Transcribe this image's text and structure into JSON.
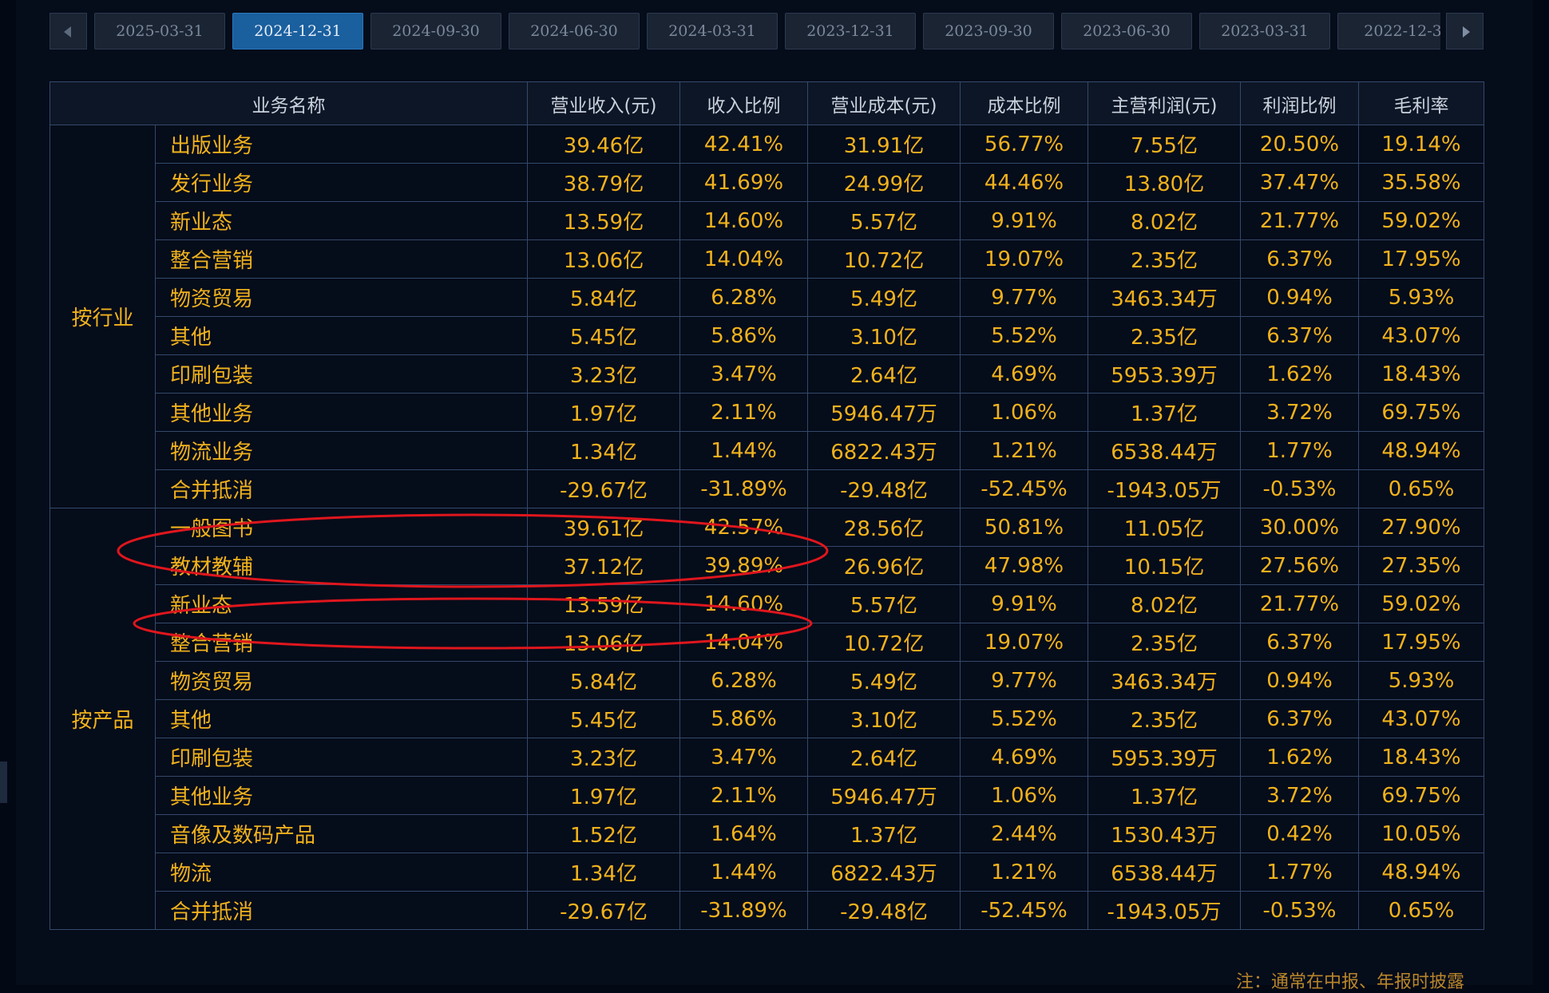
{
  "date_tabs": [
    "2025-03-31",
    "2024-12-31",
    "2024-09-30",
    "2024-06-30",
    "2024-03-31",
    "2023-12-31",
    "2023-09-30",
    "2023-06-30",
    "2023-03-31",
    "2022-12-3"
  ],
  "active_tab_index": 1,
  "table": {
    "headers": [
      "业务名称",
      "营业收入(元)",
      "收入比例",
      "营业成本(元)",
      "成本比例",
      "主营利润(元)",
      "利润比例",
      "毛利率"
    ],
    "groups": [
      {
        "label": "按行业",
        "rows": [
          [
            "出版业务",
            "39.46亿",
            "42.41%",
            "31.91亿",
            "56.77%",
            "7.55亿",
            "20.50%",
            "19.14%"
          ],
          [
            "发行业务",
            "38.79亿",
            "41.69%",
            "24.99亿",
            "44.46%",
            "13.80亿",
            "37.47%",
            "35.58%"
          ],
          [
            "新业态",
            "13.59亿",
            "14.60%",
            "5.57亿",
            "9.91%",
            "8.02亿",
            "21.77%",
            "59.02%"
          ],
          [
            "整合营销",
            "13.06亿",
            "14.04%",
            "10.72亿",
            "19.07%",
            "2.35亿",
            "6.37%",
            "17.95%"
          ],
          [
            "物资贸易",
            "5.84亿",
            "6.28%",
            "5.49亿",
            "9.77%",
            "3463.34万",
            "0.94%",
            "5.93%"
          ],
          [
            "其他",
            "5.45亿",
            "5.86%",
            "3.10亿",
            "5.52%",
            "2.35亿",
            "6.37%",
            "43.07%"
          ],
          [
            "印刷包装",
            "3.23亿",
            "3.47%",
            "2.64亿",
            "4.69%",
            "5953.39万",
            "1.62%",
            "18.43%"
          ],
          [
            "其他业务",
            "1.97亿",
            "2.11%",
            "5946.47万",
            "1.06%",
            "1.37亿",
            "3.72%",
            "69.75%"
          ],
          [
            "物流业务",
            "1.34亿",
            "1.44%",
            "6822.43万",
            "1.21%",
            "6538.44万",
            "1.77%",
            "48.94%"
          ],
          [
            "合并抵消",
            "-29.67亿",
            "-31.89%",
            "-29.48亿",
            "-52.45%",
            "-1943.05万",
            "-0.53%",
            "0.65%"
          ]
        ]
      },
      {
        "label": "按产品",
        "rows": [
          [
            "一般图书",
            "39.61亿",
            "42.57%",
            "28.56亿",
            "50.81%",
            "11.05亿",
            "30.00%",
            "27.90%"
          ],
          [
            "教材教辅",
            "37.12亿",
            "39.89%",
            "26.96亿",
            "47.98%",
            "10.15亿",
            "27.56%",
            "27.35%"
          ],
          [
            "新业态",
            "13.59亿",
            "14.60%",
            "5.57亿",
            "9.91%",
            "8.02亿",
            "21.77%",
            "59.02%"
          ],
          [
            "整合营销",
            "13.06亿",
            "14.04%",
            "10.72亿",
            "19.07%",
            "2.35亿",
            "6.37%",
            "17.95%"
          ],
          [
            "物资贸易",
            "5.84亿",
            "6.28%",
            "5.49亿",
            "9.77%",
            "3463.34万",
            "0.94%",
            "5.93%"
          ],
          [
            "其他",
            "5.45亿",
            "5.86%",
            "3.10亿",
            "5.52%",
            "2.35亿",
            "6.37%",
            "43.07%"
          ],
          [
            "印刷包装",
            "3.23亿",
            "3.47%",
            "2.64亿",
            "4.69%",
            "5953.39万",
            "1.62%",
            "18.43%"
          ],
          [
            "其他业务",
            "1.97亿",
            "2.11%",
            "5946.47万",
            "1.06%",
            "1.37亿",
            "3.72%",
            "69.75%"
          ],
          [
            "音像及数码产品",
            "1.52亿",
            "1.64%",
            "1.37亿",
            "2.44%",
            "1530.43万",
            "0.42%",
            "10.05%"
          ],
          [
            "物流",
            "1.34亿",
            "1.44%",
            "6822.43万",
            "1.21%",
            "6538.44万",
            "1.77%",
            "48.94%"
          ],
          [
            "合并抵消",
            "-29.67亿",
            "-31.89%",
            "-29.48亿",
            "-52.45%",
            "-1943.05万",
            "-0.53%",
            "0.65%"
          ]
        ]
      }
    ]
  },
  "footer_note": "注：通常在中报、年报时披露",
  "colors": {
    "background": "#050c1a",
    "value_text": "#f1b21c",
    "header_text": "#c9d2dd",
    "active_tab": "#1a5f9e",
    "grid_line": "#34496a",
    "annotation_ellipse": "#e0161d"
  },
  "icons": {
    "prev": "caret-left-icon",
    "next": "caret-right-icon"
  }
}
